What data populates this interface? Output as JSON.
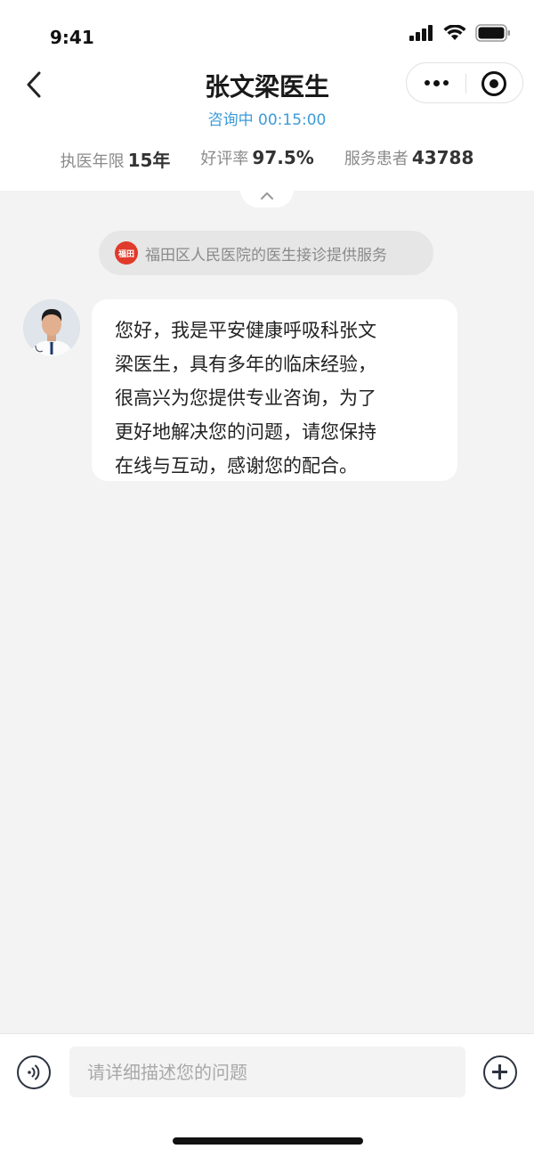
{
  "status_bar": {
    "time": "9:41"
  },
  "header": {
    "title": "张文梁医生",
    "subtitle": "咨询中 00:15:00"
  },
  "stats": [
    {
      "label": "执医年限",
      "value": "15年"
    },
    {
      "label": "好评率",
      "value": "97.5%"
    },
    {
      "label": "服务患者",
      "value": "43788"
    }
  ],
  "notice": {
    "logo_text": "福田",
    "text": "福田区人民医院的医生接诊提供服务"
  },
  "messages": [
    {
      "sender": "doctor",
      "lines": [
        "您好，我是平安健康呼吸科张文",
        "梁医生，具有多年的临床经验，",
        "很高兴为您提供专业咨询，为了",
        "更好地解决您的问题，请您保持",
        "在线与互动，感谢您的配合。"
      ]
    }
  ],
  "input": {
    "placeholder": "请详细描述您的问题"
  },
  "colors": {
    "accent": "#3b9bd9",
    "background": "#f3f3f3",
    "logo_red": "#e03a2a"
  }
}
